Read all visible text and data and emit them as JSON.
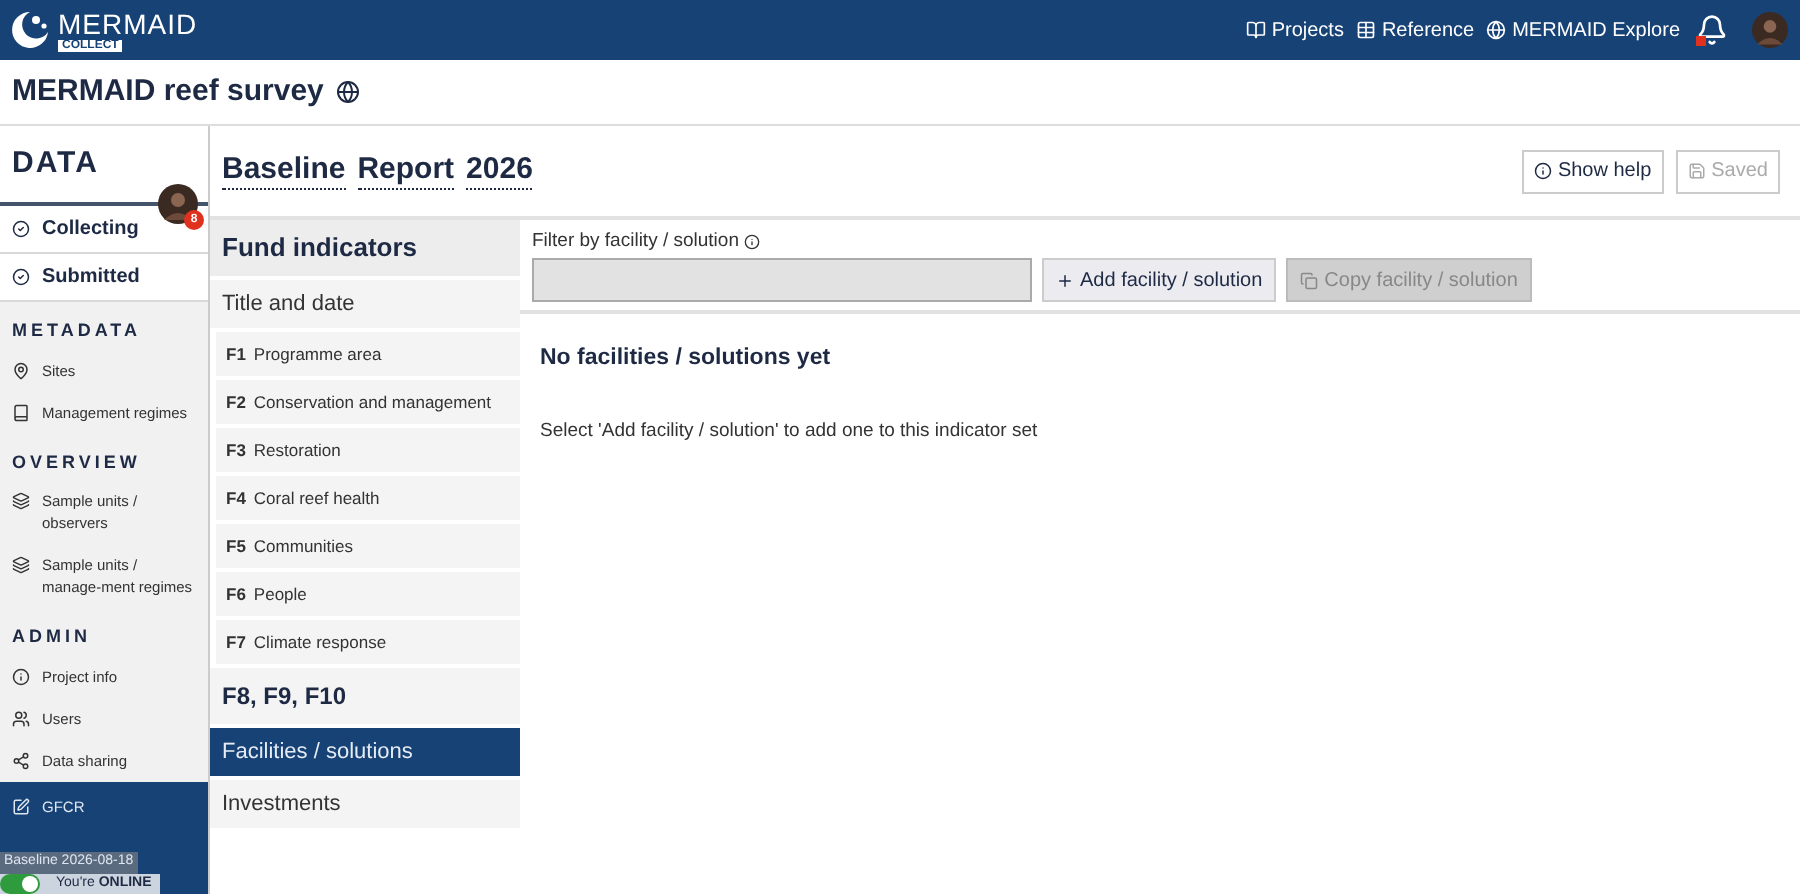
{
  "top_bar": {
    "logo": {
      "name": "MERMAID",
      "tag": "COLLECT"
    },
    "links": [
      {
        "label": "Projects"
      },
      {
        "label": "Reference"
      },
      {
        "label": "MERMAID Explore"
      }
    ],
    "notifications": {
      "unread": true
    }
  },
  "project": {
    "title": "MERMAID reef survey"
  },
  "sidebar": {
    "title": "DATA",
    "collecting": {
      "badge": "8"
    },
    "items": [
      {
        "kind": "data",
        "label": "Collecting",
        "selected": false
      },
      {
        "kind": "data",
        "label": "Submitted",
        "selected": false
      },
      {
        "kind": "heading",
        "label": "METADATA"
      },
      {
        "kind": "link",
        "label": "Sites",
        "selected": false
      },
      {
        "kind": "link",
        "label": "Management regimes",
        "selected": false
      },
      {
        "kind": "heading",
        "label": "OVERVIEW"
      },
      {
        "kind": "link",
        "label": "Sample units / observers",
        "selected": false
      },
      {
        "kind": "link",
        "label": "Sample units / manage-ment regimes",
        "selected": false
      },
      {
        "kind": "heading",
        "label": "ADMIN"
      },
      {
        "kind": "link",
        "label": "Project info",
        "selected": false
      },
      {
        "kind": "link",
        "label": "Users",
        "selected": false
      },
      {
        "kind": "link",
        "label": "Data sharing",
        "selected": false
      },
      {
        "kind": "link",
        "label": "GFCR",
        "selected": true
      }
    ],
    "tooltip": "Baseline 2026-08-18",
    "online": {
      "on": true,
      "text": "You're **ONLINE**"
    }
  },
  "report": {
    "title_words": [
      "Baseline",
      "Report",
      "2026"
    ],
    "buttons": [
      {
        "label": "Show help",
        "disabled": false
      },
      {
        "label": "Saved",
        "disabled": true
      }
    ]
  },
  "indicators": [
    {
      "kind": "heading",
      "label": "Fund indicators",
      "selected": false
    },
    {
      "kind": "section",
      "label": "Title and date",
      "selected": false
    },
    {
      "kind": "indicator",
      "code": "F1",
      "label": "Programme area",
      "selected": false
    },
    {
      "kind": "indicator",
      "code": "F2",
      "label": "Conservation and management",
      "selected": false
    },
    {
      "kind": "indicator",
      "code": "F3",
      "label": "Restoration",
      "selected": false
    },
    {
      "kind": "indicator",
      "code": "F4",
      "label": "Coral reef health",
      "selected": false
    },
    {
      "kind": "indicator",
      "code": "F5",
      "label": "Communities",
      "selected": false
    },
    {
      "kind": "indicator",
      "code": "F6",
      "label": "People",
      "selected": false
    },
    {
      "kind": "indicator",
      "code": "F7",
      "label": "Climate response",
      "selected": false
    },
    {
      "kind": "group",
      "label": "F8, F9, F10",
      "selected": false
    },
    {
      "kind": "section",
      "label": "Facilities / solutions",
      "selected": true
    },
    {
      "kind": "section",
      "label": "Investments",
      "selected": false
    }
  ],
  "facilities": {
    "filter": {
      "label": "Filter by facility / solution"
    },
    "buttons": [
      {
        "label": "Add facility / solution",
        "disabled": false
      },
      {
        "label": "Copy facility / solution",
        "disabled": true
      }
    ],
    "empty_title": "No facilities / solutions yet",
    "empty_text": "Select 'Add facility / solution' to add one to this indicator set"
  }
}
